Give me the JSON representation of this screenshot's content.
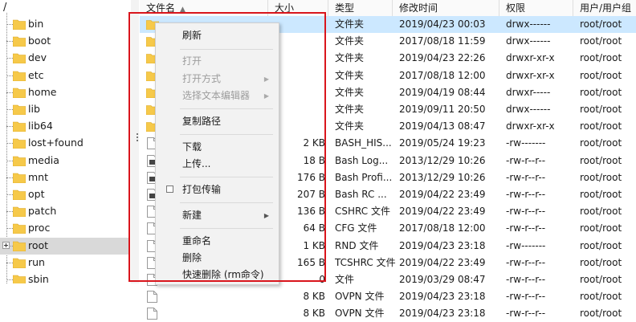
{
  "tree": {
    "root": "/",
    "items": [
      {
        "label": "bin"
      },
      {
        "label": "boot"
      },
      {
        "label": "dev"
      },
      {
        "label": "etc"
      },
      {
        "label": "home"
      },
      {
        "label": "lib"
      },
      {
        "label": "lib64"
      },
      {
        "label": "lost+found"
      },
      {
        "label": "media"
      },
      {
        "label": "mnt"
      },
      {
        "label": "opt"
      },
      {
        "label": "patch"
      },
      {
        "label": "proc"
      },
      {
        "label": "root"
      },
      {
        "label": "run"
      },
      {
        "label": "sbin"
      }
    ]
  },
  "columns": {
    "name": "文件名",
    "size": "大小",
    "type": "类型",
    "modified": "修改时间",
    "perm": "权限",
    "owner": "用户/用户组"
  },
  "files": [
    {
      "name": ".",
      "size": "",
      "type": "文件夹",
      "modified": "2019/04/23 00:03",
      "perm": "drwx------",
      "owner": "root/root",
      "icon": "folder-icon"
    },
    {
      "name": "",
      "size": "",
      "type": "文件夹",
      "modified": "2017/08/18 11:59",
      "perm": "drwx------",
      "owner": "root/root",
      "icon": "folder-icon"
    },
    {
      "name": "",
      "size": "",
      "type": "文件夹",
      "modified": "2019/04/23 22:26",
      "perm": "drwxr-xr-x",
      "owner": "root/root",
      "icon": "folder-icon"
    },
    {
      "name": "",
      "size": "",
      "type": "文件夹",
      "modified": "2017/08/18 12:00",
      "perm": "drwxr-xr-x",
      "owner": "root/root",
      "icon": "folder-icon"
    },
    {
      "name": "",
      "size": "",
      "type": "文件夹",
      "modified": "2019/04/19 08:44",
      "perm": "drwxr-----",
      "owner": "root/root",
      "icon": "folder-icon"
    },
    {
      "name": "",
      "size": "",
      "type": "文件夹",
      "modified": "2019/09/11 20:50",
      "perm": "drwx------",
      "owner": "root/root",
      "icon": "folder-icon"
    },
    {
      "name": "",
      "size": "",
      "type": "文件夹",
      "modified": "2019/04/13 08:47",
      "perm": "drwxr-xr-x",
      "owner": "root/root",
      "icon": "folder-icon"
    },
    {
      "name": "",
      "size": "2 KB",
      "type": "BASH_HIS...",
      "modified": "2019/05/24 19:23",
      "perm": "-rw-------",
      "owner": "root/root",
      "icon": "file-icon"
    },
    {
      "name": "",
      "size": "18 B",
      "type": "Bash Log...",
      "modified": "2013/12/29 10:26",
      "perm": "-rw-r--r--",
      "owner": "root/root",
      "icon": "script-icon"
    },
    {
      "name": "",
      "size": "176 B",
      "type": "Bash Profi...",
      "modified": "2013/12/29 10:26",
      "perm": "-rw-r--r--",
      "owner": "root/root",
      "icon": "script-icon"
    },
    {
      "name": "",
      "size": "207 B",
      "type": "Bash RC ...",
      "modified": "2019/04/22 23:49",
      "perm": "-rw-r--r--",
      "owner": "root/root",
      "icon": "script-icon"
    },
    {
      "name": "",
      "size": "136 B",
      "type": "CSHRC 文件",
      "modified": "2019/04/22 23:49",
      "perm": "-rw-r--r--",
      "owner": "root/root",
      "icon": "file-icon"
    },
    {
      "name": "",
      "size": "64 B",
      "type": "CFG 文件",
      "modified": "2017/08/18 12:00",
      "perm": "-rw-r--r--",
      "owner": "root/root",
      "icon": "file-icon"
    },
    {
      "name": "",
      "size": "1 KB",
      "type": "RND 文件",
      "modified": "2019/04/23 23:18",
      "perm": "-rw-------",
      "owner": "root/root",
      "icon": "file-icon"
    },
    {
      "name": "",
      "size": "165 B",
      "type": "TCSHRC 文件",
      "modified": "2019/04/22 23:49",
      "perm": "-rw-r--r--",
      "owner": "root/root",
      "icon": "file-icon"
    },
    {
      "name": "",
      "size": "0",
      "type": "文件",
      "modified": "2019/03/29 08:47",
      "perm": "-rw-r--r--",
      "owner": "root/root",
      "icon": "file-icon"
    },
    {
      "name": "",
      "size": "8 KB",
      "type": "OVPN 文件",
      "modified": "2019/04/23 23:18",
      "perm": "-rw-r--r--",
      "owner": "root/root",
      "icon": "file-icon"
    },
    {
      "name": "",
      "size": "8 KB",
      "type": "OVPN 文件",
      "modified": "2019/04/23 23:18",
      "perm": "-rw-r--r--",
      "owner": "root/root",
      "icon": "file-icon"
    }
  ],
  "menu": {
    "refresh": "刷新",
    "open": "打开",
    "open_with": "打开方式",
    "choose_editor": "选择文本编辑器",
    "copy_path": "复制路径",
    "download": "下载",
    "upload": "上传...",
    "pack_transfer": "打包传输",
    "new": "新建",
    "rename": "重命名",
    "delete": "删除",
    "quick_delete": "快速删除 (rm命令)"
  },
  "colors": {
    "highlight": "#d9151c",
    "selection": "#cce8ff",
    "folder": "#f6c94a"
  }
}
